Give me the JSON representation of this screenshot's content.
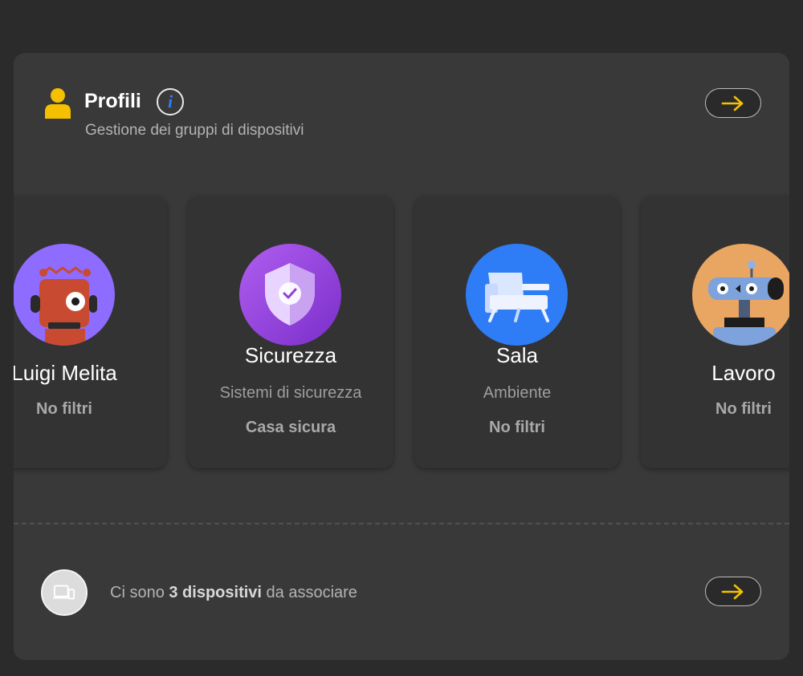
{
  "header": {
    "title": "Profili",
    "subtitle": "Gestione dei gruppi di dispositivi",
    "icon": "person-icon",
    "info_glyph": "i"
  },
  "colors": {
    "accent": "#f5c000",
    "info": "#2f7df6",
    "panel": "#393939",
    "card": "#333333"
  },
  "profiles": [
    {
      "name": "Luigi Melita",
      "subtitle": "",
      "status": "No filtri",
      "avatar": "robot-avatar-icon",
      "avatar_color": "#8e6cff"
    },
    {
      "name": "Sicurezza",
      "subtitle": "Sistemi di sicurezza",
      "status": "Casa sicura",
      "avatar": "shield-icon",
      "avatar_color": "#8f3fd8"
    },
    {
      "name": "Sala",
      "subtitle": "Ambiente",
      "status": "No filtri",
      "avatar": "armchair-icon",
      "avatar_color": "#2f7df6"
    },
    {
      "name": "Lavoro",
      "subtitle": "",
      "status": "No filtri",
      "avatar": "robot-head-icon",
      "avatar_color": "#e9a663"
    }
  ],
  "footer": {
    "text_before": "Ci sono ",
    "count_text": "3 dispositivi",
    "text_after": " da associare",
    "icon": "devices-icon"
  }
}
